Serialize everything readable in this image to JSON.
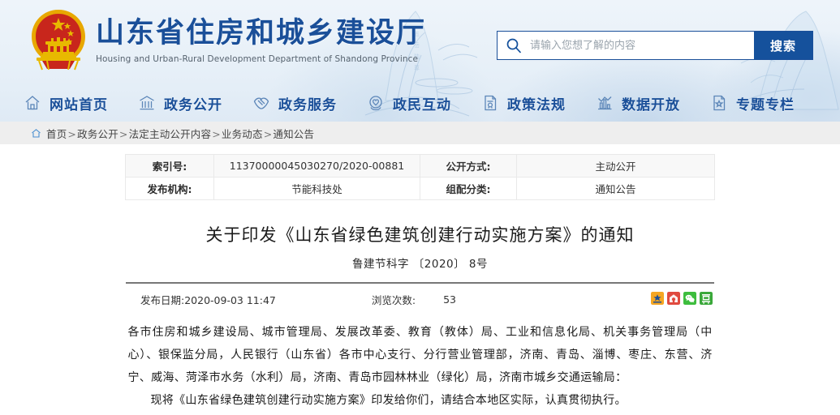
{
  "site": {
    "title_cn": "山东省住房和城乡建设厅",
    "title_en": "Housing and Urban-Rural Development Department of Shandong Province",
    "emblem_icon": "national-emblem-icon",
    "brand_color": "#1a4f99"
  },
  "search": {
    "placeholder": "请输入您想了解的内容",
    "value": "",
    "button_label": "搜索",
    "icon": "search-icon",
    "button_color": "#15519c"
  },
  "nav": {
    "items": [
      {
        "label": "网站首页",
        "icon": "home-icon"
      },
      {
        "label": "政务公开",
        "icon": "bank-icon"
      },
      {
        "label": "政务服务",
        "icon": "handshake-icon"
      },
      {
        "label": "政民互动",
        "icon": "heart-chat-icon"
      },
      {
        "label": "政策法规",
        "icon": "document-law-icon"
      },
      {
        "label": "数据开放",
        "icon": "bar-chart-icon"
      },
      {
        "label": "专题专栏",
        "icon": "star-document-icon"
      }
    ]
  },
  "breadcrumb": {
    "home_icon": "home-small-icon",
    "items": [
      "首页",
      "政务公开",
      "法定主动公开内容",
      "业务动态",
      "通知公告"
    ],
    "separator": ">"
  },
  "info_table": {
    "rows": [
      {
        "label1": "索引号:",
        "value1": "11370000045030270/2020-00881",
        "label2": "公开方式:",
        "value2": "主动公开"
      },
      {
        "label1": "发布机构:",
        "value1": "节能科技处",
        "label2": "组配分类:",
        "value2": "通知公告"
      }
    ]
  },
  "document": {
    "title": "关于印发《山东省绿色建筑创建行动实施方案》的通知",
    "subtitle": "鲁建节科字 〔2020〕 8号",
    "publish_date_label": "发布日期:2020-09-03 11:47",
    "views_label": "浏览次数:",
    "views_count": "53",
    "share_icons": [
      {
        "name": "sina-weibo-share-icon",
        "color": "#f5a623"
      },
      {
        "name": "renren-share-icon",
        "color": "#e04a3f"
      },
      {
        "name": "wechat-share-icon",
        "color": "#3dbd3d"
      },
      {
        "name": "douban-share-icon",
        "color": "#3aa83a"
      }
    ],
    "paragraphs": [
      "各市住房和城乡建设局、城市管理局、发展改革委、教育（教体）局、工业和信息化局、机关事务管理局（中心）、银保监分局，人民银行（山东省）各市中心支行、分行营业管理部，济南、青岛、淄博、枣庄、东营、济宁、威海、菏泽市水务（水利）局，济南、青岛市园林林业（绿化）局，济南市城乡交通运输局：",
      "现将《山东省绿色建筑创建行动实施方案》印发给你们，请结合本地区实际，认真贯彻执行。"
    ]
  }
}
